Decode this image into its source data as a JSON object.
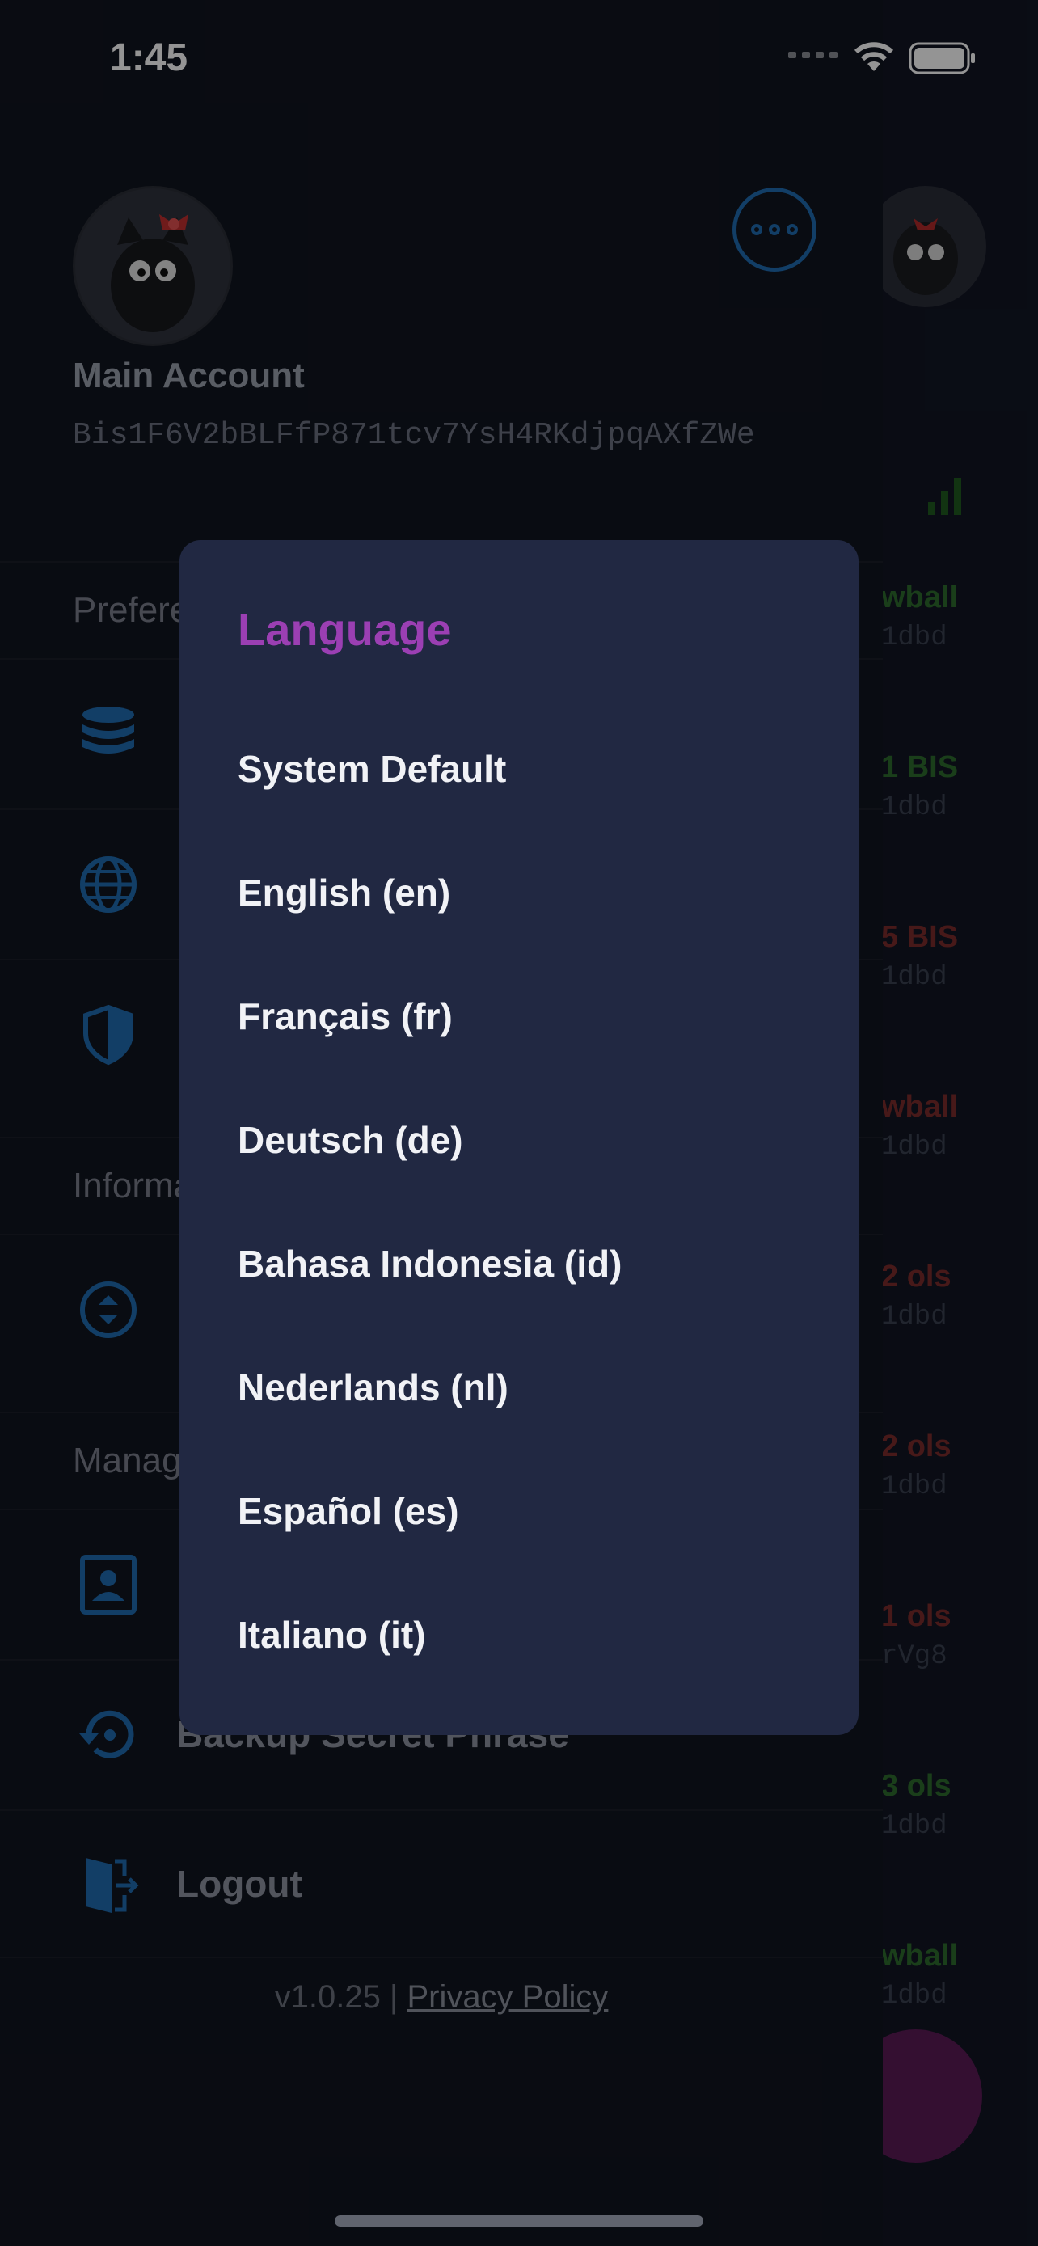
{
  "status_bar": {
    "time": "1:45"
  },
  "account": {
    "name": "Main Account",
    "address": "Bis1F6V2bBLFfP871tcv7YsH4RKdjpqAXfZWe"
  },
  "sections": {
    "preferences": "Preferences",
    "information": "Information",
    "manage": "Manage"
  },
  "menu": {
    "backup": "Backup Secret Phrase",
    "logout": "Logout"
  },
  "footer": {
    "version": "v1.0.25 | ",
    "privacy": "Privacy Policy"
  },
  "dialog": {
    "title": "Language",
    "options": [
      "System Default",
      "English (en)",
      "Français (fr)",
      "Deutsch (de)",
      "Bahasa Indonesia (id)",
      "Nederlands (nl)",
      "Español (es)",
      "Italiano (it)"
    ]
  },
  "background_list": [
    {
      "amount": "wball",
      "address": "1dbd",
      "color": "#2e6b2e"
    },
    {
      "amount": "1 BIS",
      "address": "1dbd",
      "color": "#2e6b2e"
    },
    {
      "amount": "5 BIS",
      "address": "1dbd",
      "color": "#7a2b2b"
    },
    {
      "amount": "wball",
      "address": "1dbd",
      "color": "#7a2b2b"
    },
    {
      "amount": "2 ols",
      "address": "1dbd",
      "color": "#7a2b2b"
    },
    {
      "amount": "2 ols",
      "address": "1dbd",
      "color": "#7a2b2b"
    },
    {
      "amount": "1 ols",
      "address": "rVg8",
      "color": "#7a2b2b"
    },
    {
      "amount": "3 ols",
      "address": "1dbd",
      "color": "#2e6b2e"
    },
    {
      "amount": "wball",
      "address": "1dbd",
      "color": "#2e6b2e"
    }
  ],
  "colors": {
    "accent_blue": "#1f6cb0",
    "title_purple": "#9b3fb3",
    "dialog_bg": "#212842"
  }
}
